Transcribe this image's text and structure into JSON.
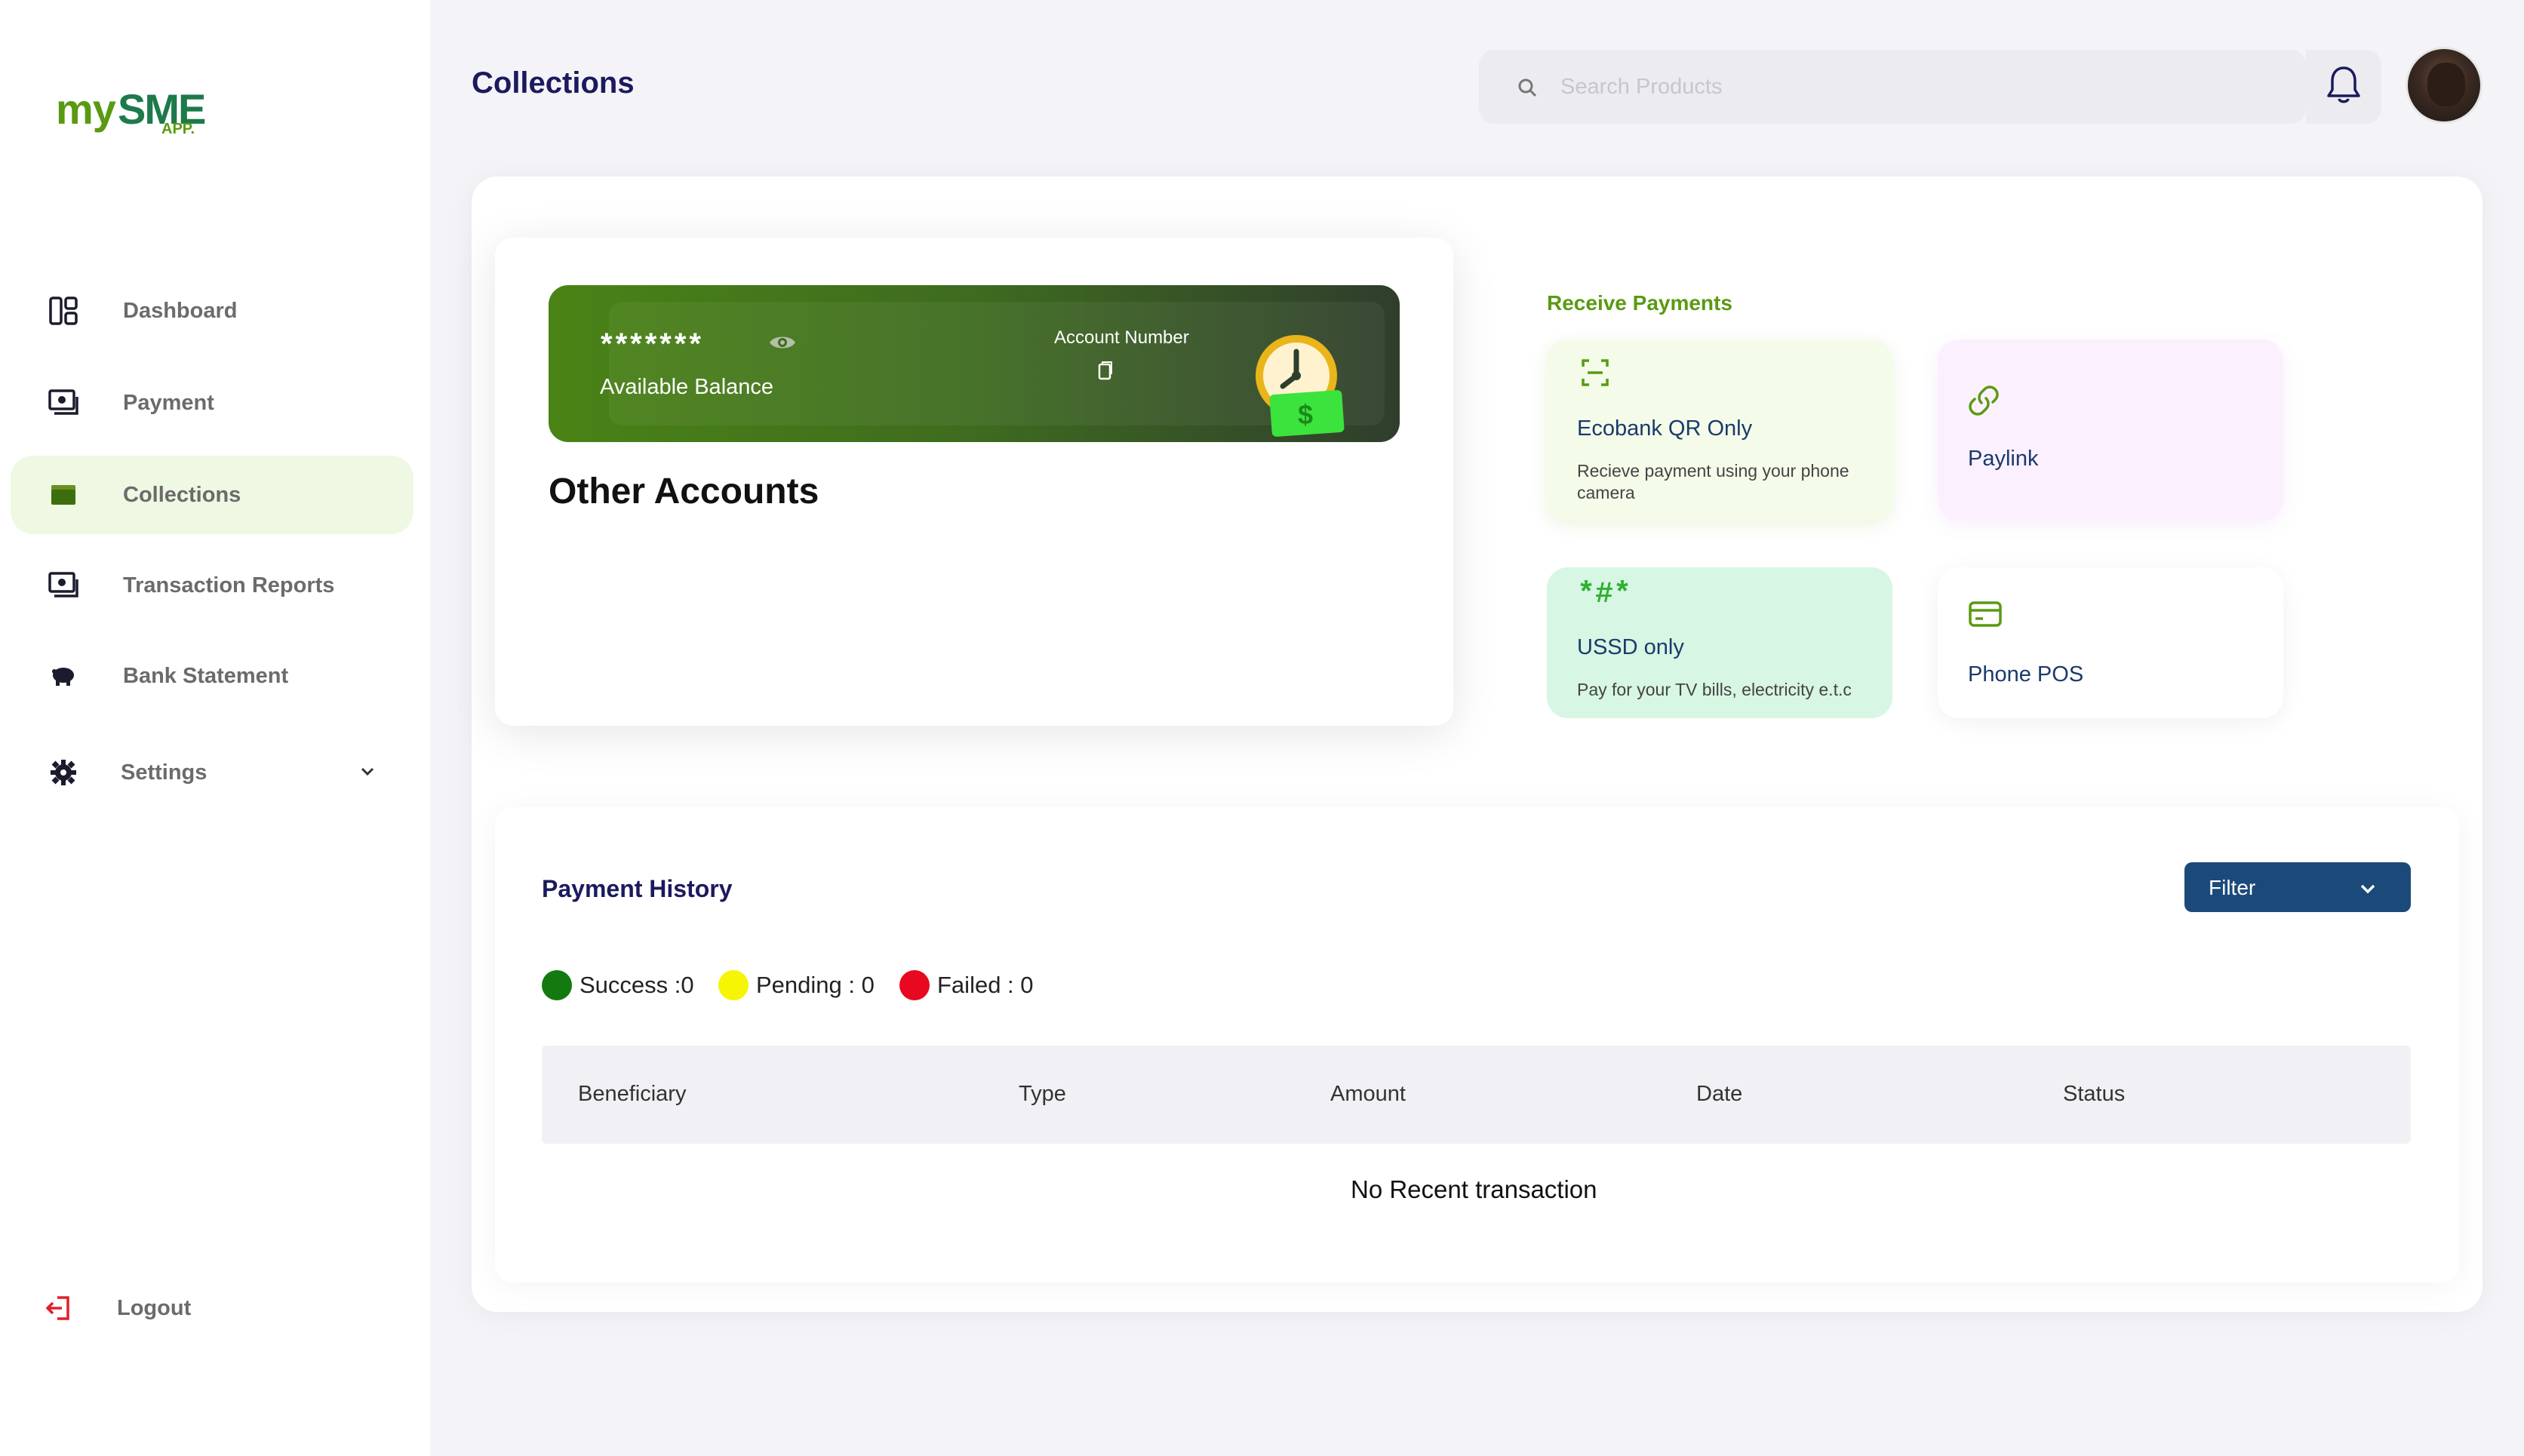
{
  "brand": {
    "logo_my": "my",
    "logo_sme": "SME",
    "logo_app": "APP."
  },
  "sidebar": {
    "items": [
      {
        "label": "Dashboard",
        "icon": "dashboard-icon"
      },
      {
        "label": "Payment",
        "icon": "money-icon"
      },
      {
        "label": "Collections",
        "icon": "wallet-icon",
        "active": true
      },
      {
        "label": "Transaction Reports",
        "icon": "money-icon"
      },
      {
        "label": "Bank Statement",
        "icon": "piggy-bank-icon"
      },
      {
        "label": "Settings",
        "icon": "gear-icon"
      }
    ],
    "logout": "Logout"
  },
  "header": {
    "title": "Collections",
    "search_placeholder": "Search Products"
  },
  "balance": {
    "masked": "*******",
    "label": "Available Balance",
    "account_label": "Account Number"
  },
  "other_accounts": "Other Accounts",
  "receive": {
    "title": "Receive Payments",
    "tiles": [
      {
        "title": "Ecobank QR Only",
        "desc": "Recieve payment using your phone camera",
        "icon": "qr-scan-icon"
      },
      {
        "title": "Paylink",
        "desc": "",
        "icon": "link-icon"
      },
      {
        "title": "USSD only",
        "desc": "Pay for your TV bills, electricity e.t.c",
        "icon": "ussd-icon",
        "icon_text": "*#*"
      },
      {
        "title": "Phone POS",
        "desc": "",
        "icon": "card-icon"
      }
    ]
  },
  "history": {
    "title": "Payment History",
    "filter_label": "Filter",
    "legend": [
      {
        "label": "Success :0",
        "color": "#137a0f"
      },
      {
        "label": "Pending : 0",
        "color": "#f5f505"
      },
      {
        "label": "Failed : 0",
        "color": "#e8081f"
      }
    ],
    "columns": [
      "Beneficiary",
      "Type",
      "Amount",
      "Date",
      "Status"
    ],
    "empty": "No Recent transaction"
  },
  "colors": {
    "accent_green": "#5a9a12",
    "navy": "#1b1a5e",
    "filter_blue": "#1b4a7a",
    "active_nav_bg": "#eef8e3"
  }
}
